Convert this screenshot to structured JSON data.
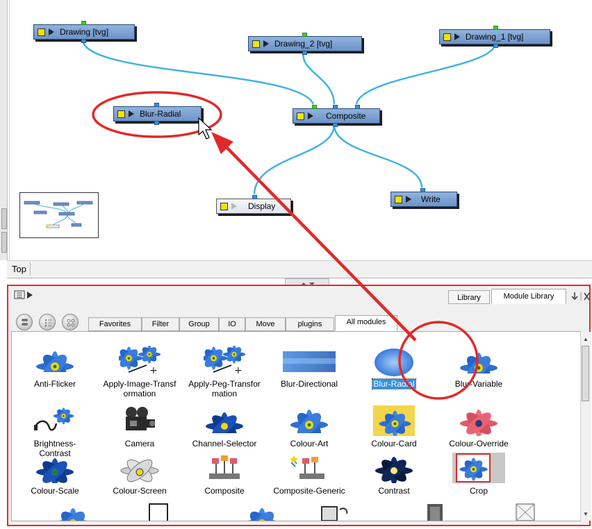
{
  "node_view": {
    "nodes": {
      "drawing": "Drawing [tvg]",
      "drawing_2": "Drawing_2 [tvg]",
      "drawing_1": "Drawing_1 [tvg]",
      "blur_radial": "Blur-Radial",
      "composite": "Composite",
      "display": "Display",
      "write": "Write"
    }
  },
  "view_tab": "Top",
  "library_panel": {
    "top_tabs": [
      "Library",
      "Module Library"
    ],
    "active_top_tab": "Module Library",
    "category_tabs": [
      "Favorites",
      "Filter",
      "Group",
      "IO",
      "Move",
      "plugins",
      "All modules"
    ],
    "active_category_tab": "All modules",
    "modules": [
      "Anti-Flicker",
      "Apply-Image-Transformation",
      "Apply-Peg-Transformation",
      "Blur-Directional",
      "Blur-Radial",
      "Blur-Variable",
      "Brightness-Contrast",
      "Camera",
      "Channel-Selector",
      "Colour-Art",
      "Colour-Card",
      "Colour-Override",
      "Colour-Scale",
      "Colour-Screen",
      "Composite",
      "Composite-Generic",
      "Contrast",
      "Crop"
    ],
    "module_label_lines": {
      "apply_image_1": "Apply-Image-Transf",
      "apply_image_2": "ormation",
      "apply_peg_1": "Apply-Peg-Transfor",
      "apply_peg_2": "mation"
    },
    "selected_module": "Blur-Radial"
  },
  "colors": {
    "node_blue": "#7aa0d3",
    "annotation_red": "#e02a2a",
    "wire_blue": "#41b3e0",
    "selection_blue": "#3390e0"
  },
  "icons": [
    "panel-menu-icon",
    "view-mode-icons",
    "module-icons",
    "cursor-arrow-icon"
  ]
}
